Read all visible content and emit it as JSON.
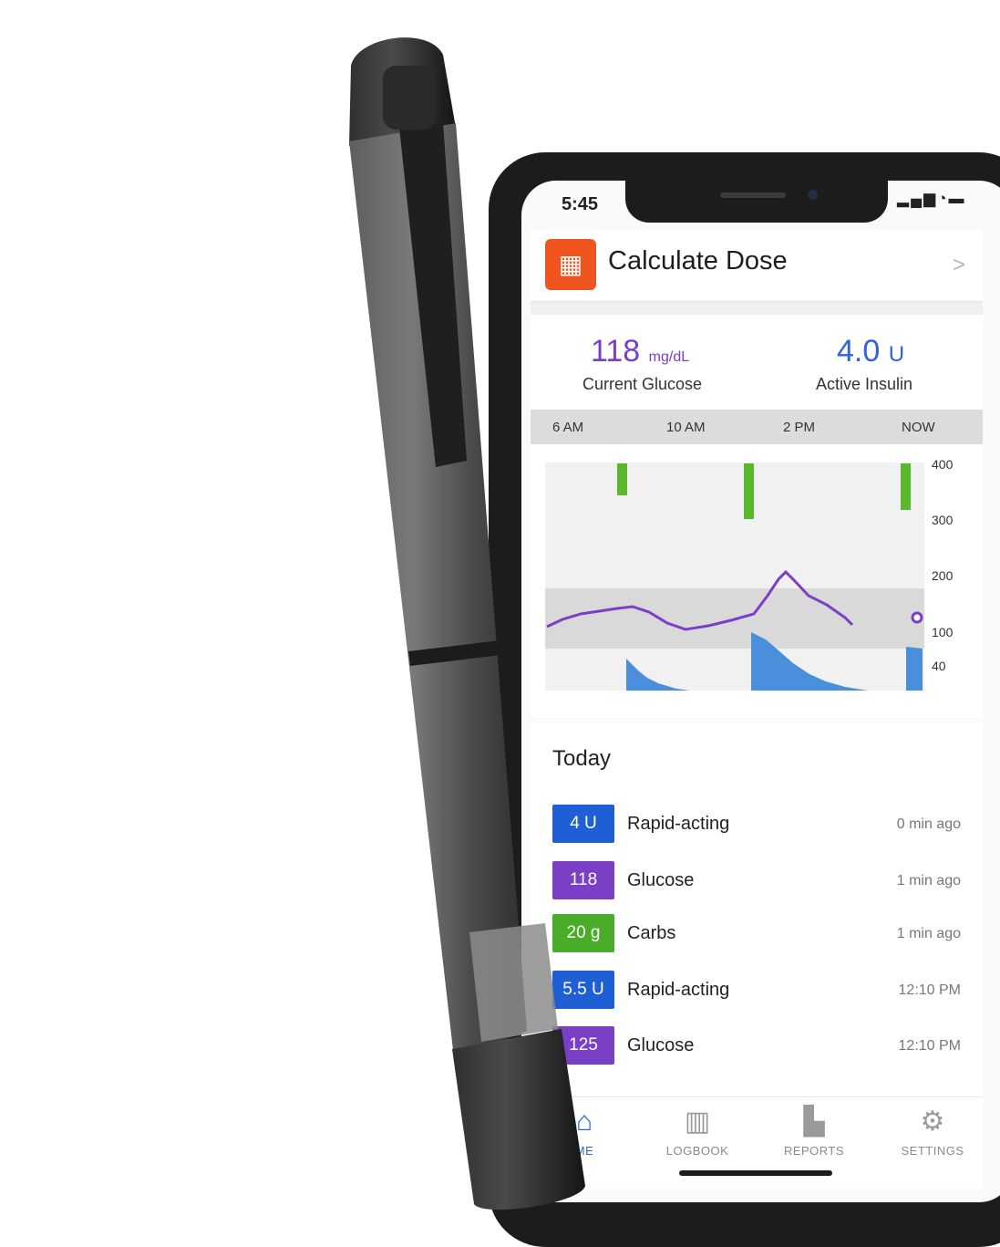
{
  "status_bar": {
    "time": "5:45"
  },
  "header": {
    "title": "Calculate Dose",
    "icon": "calculator-icon",
    "chevron": ">"
  },
  "stats": {
    "glucose": {
      "value": "118",
      "unit": "mg/dL",
      "label": "Current Glucose"
    },
    "insulin": {
      "value": "4.0",
      "unit": "U",
      "label": "Active Insulin"
    }
  },
  "timeline": [
    "6 AM",
    "10 AM",
    "2 PM",
    "NOW"
  ],
  "chart_data": {
    "type": "line",
    "x": [
      "6 AM",
      "10 AM",
      "2 PM",
      "NOW"
    ],
    "y_ticks": [
      "400",
      "300",
      "200",
      "100",
      "40"
    ],
    "ylim": [
      40,
      400
    ],
    "target_range": [
      80,
      180
    ],
    "glucose_current": 118,
    "colors": {
      "glucose": "#7b3fc7",
      "carbs": "#5ab82d",
      "insulin": "#4a8fdc",
      "target_band": "#d9d9d9"
    }
  },
  "today": {
    "title": "Today",
    "rows": [
      {
        "badge": "4 U",
        "color": "#1f5fd6",
        "label": "Rapid-acting",
        "time": "0 min ago"
      },
      {
        "badge": "118",
        "color": "#7b3fc7",
        "label": "Glucose",
        "time": "1 min ago"
      },
      {
        "badge": "20 g",
        "color": "#49ad29",
        "label": "Carbs",
        "time": "1 min ago"
      },
      {
        "badge": "5.5 U",
        "color": "#1f5fd6",
        "label": "Rapid-acting",
        "time": "12:10 PM"
      },
      {
        "badge": "125",
        "color": "#7b3fc7",
        "label": "Glucose",
        "time": "12:10 PM"
      }
    ]
  },
  "nav": [
    {
      "label": "ME",
      "icon": "home-icon",
      "color": "#2f63d8"
    },
    {
      "label": "LOGBOOK",
      "icon": "logbook-icon",
      "color": "#9a9a9a"
    },
    {
      "label": "REPORTS",
      "icon": "reports-icon",
      "color": "#9a9a9a"
    },
    {
      "label": "SETTINGS",
      "icon": "gear-icon",
      "color": "#9a9a9a"
    }
  ]
}
